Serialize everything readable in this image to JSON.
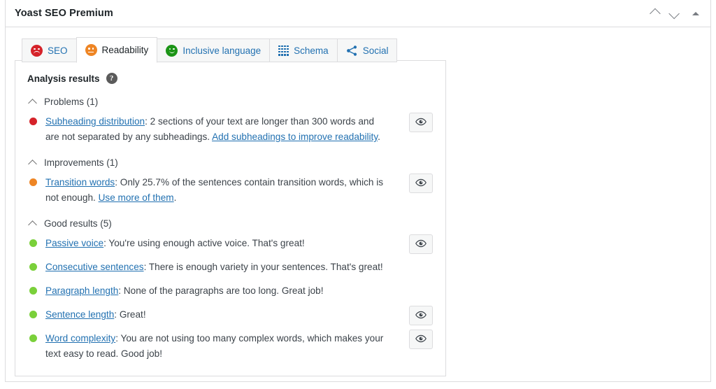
{
  "header": {
    "title": "Yoast SEO Premium",
    "actions": [
      {
        "name": "move-up-button",
        "icon": "chevron-up-icon"
      },
      {
        "name": "move-down-button",
        "icon": "chevron-down-icon"
      },
      {
        "name": "toggle-panel-button",
        "icon": "triangle-up-icon"
      }
    ]
  },
  "tabs": [
    {
      "label": "SEO",
      "icon": "sad-face-icon",
      "icon_color": "#d5232a",
      "active": false
    },
    {
      "label": "Readability",
      "icon": "neutral-face-icon",
      "icon_color": "#ee8524",
      "active": true
    },
    {
      "label": "Inclusive language",
      "icon": "happy-face-icon",
      "icon_color": "#1b9416",
      "active": false
    },
    {
      "label": "Schema",
      "icon": "grid-icon",
      "icon_color": "#2271b1",
      "active": false
    },
    {
      "label": "Social",
      "icon": "share-icon",
      "icon_color": "#2271b1",
      "active": false
    }
  ],
  "analysis": {
    "title": "Analysis results",
    "help_icon": "help-circle-icon",
    "help_glyph": "?",
    "sections": [
      {
        "heading": "Problems (1)",
        "collapse_icon": "chevron-up-icon",
        "items": [
          {
            "bullet": "red",
            "link": "Subheading distribution",
            "text": ": 2 sections of your text are longer than 300 words and are not separated by any subheadings. ",
            "cta": "Add subheadings to improve readability",
            "tail": ".",
            "has_eye": true,
            "eye_icon": "eye-icon"
          }
        ]
      },
      {
        "heading": "Improvements (1)",
        "collapse_icon": "chevron-up-icon",
        "items": [
          {
            "bullet": "orange",
            "link": "Transition words",
            "text": ": Only 25.7% of the sentences contain transition words, which is not enough. ",
            "cta": "Use more of them",
            "tail": ".",
            "has_eye": true,
            "eye_icon": "eye-icon"
          }
        ]
      },
      {
        "heading": "Good results (5)",
        "collapse_icon": "chevron-up-icon",
        "items": [
          {
            "bullet": "green",
            "link": "Passive voice",
            "text": ": You're using enough active voice. That's great!",
            "cta": "",
            "tail": "",
            "has_eye": true,
            "eye_icon": "eye-icon"
          },
          {
            "bullet": "green",
            "link": "Consecutive sentences",
            "text": ": There is enough variety in your sentences. That's great!",
            "cta": "",
            "tail": "",
            "has_eye": false,
            "eye_icon": "eye-icon"
          },
          {
            "bullet": "green",
            "link": "Paragraph length",
            "text": ": None of the paragraphs are too long. Great job!",
            "cta": "",
            "tail": "",
            "has_eye": false,
            "eye_icon": "eye-icon"
          },
          {
            "bullet": "green",
            "link": "Sentence length",
            "text": ": Great!",
            "cta": "",
            "tail": "",
            "has_eye": true,
            "eye_icon": "eye-icon"
          },
          {
            "bullet": "green",
            "link": "Word complexity",
            "text": ": You are not using too many complex words, which makes your text easy to read. Good job!",
            "cta": "",
            "tail": "",
            "has_eye": true,
            "eye_icon": "eye-icon"
          }
        ]
      }
    ]
  },
  "colors": {
    "link": "#2271b1",
    "red": "#d5232a",
    "orange": "#ee8524",
    "green": "#7ad03a",
    "border": "#dcdcde",
    "text": "#3c434a"
  }
}
